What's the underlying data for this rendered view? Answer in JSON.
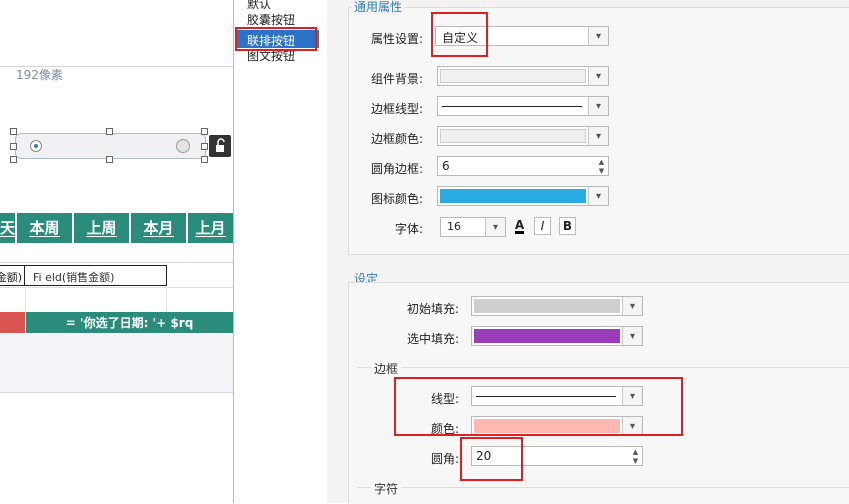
{
  "canvas": {
    "size_hint": "192像素",
    "tabs": [
      "天",
      "本周",
      "上周",
      "本月",
      "上月"
    ],
    "cell_left": "金额)",
    "cell_formula": "Fi eld(销售金额)",
    "row_formula": "= '你选了日期: '+ $rq",
    "colors": {
      "tab_bg": "#2a8c7a",
      "red_cell": "#d9534f"
    }
  },
  "style_list": {
    "items": [
      "默认",
      "胶囊按钮",
      "联排按钮",
      "图文按钮"
    ],
    "selected": "联排按钮"
  },
  "general": {
    "title": "通用属性",
    "attr_label": "属性设置:",
    "attr_value": "自定义",
    "bg_label": "组件背景:",
    "border_style_label": "边框线型:",
    "border_color_label": "边框颜色:",
    "radius_label": "圆角边框:",
    "radius_value": "6",
    "icon_color_label": "图标颜色:",
    "icon_color": "#29abe2",
    "font_label": "字体:",
    "font_size": "16",
    "font_buttons": [
      "A",
      "I",
      "B"
    ]
  },
  "settings": {
    "title": "设定",
    "init_fill_label": "初始填充:",
    "init_fill_color": "#cfcfcf",
    "sel_fill_label": "选中填充:",
    "sel_fill_color": "#9b3db8",
    "border_section": "边框",
    "line_label": "线型:",
    "color_label": "颜色:",
    "border_color": "#ffb8b0",
    "radius_label": "圆角:",
    "radius_value": "20",
    "font_section": "字符"
  }
}
